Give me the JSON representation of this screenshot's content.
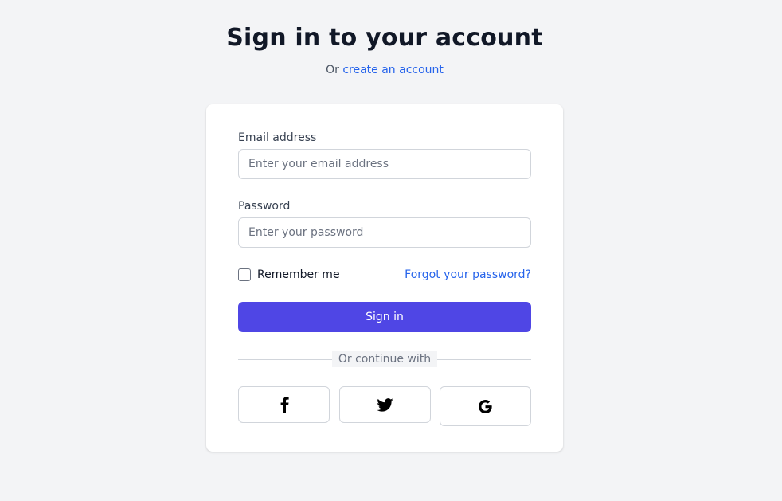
{
  "header": {
    "title": "Sign in to your account",
    "subtitle_prefix": "Or ",
    "create_account_link": "create an account"
  },
  "form": {
    "email": {
      "label": "Email address",
      "placeholder": "Enter your email address",
      "value": ""
    },
    "password": {
      "label": "Password",
      "placeholder": "Enter your password",
      "value": ""
    },
    "remember_me": {
      "label": "Remember me",
      "checked": false
    },
    "forgot_password_link": "Forgot your password?",
    "submit_label": "Sign in",
    "divider_text": "Or continue with",
    "social_buttons": [
      {
        "icon": "facebook-icon"
      },
      {
        "icon": "twitter-icon"
      },
      {
        "icon": "google-icon"
      }
    ]
  },
  "colors": {
    "background": "#f3f4f6",
    "primary": "#4f46e5",
    "link": "#2563eb",
    "text": "#111827"
  }
}
